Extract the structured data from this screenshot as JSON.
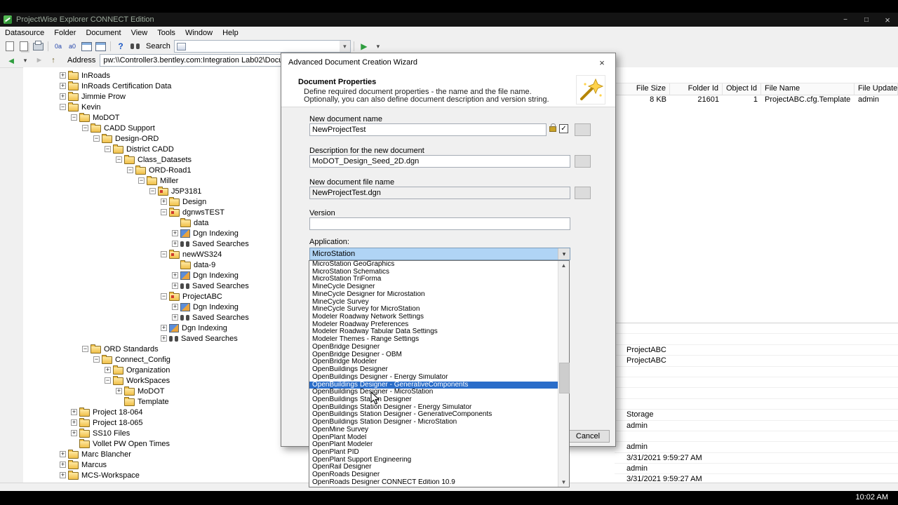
{
  "video": {
    "clock": "10:02 AM"
  },
  "titlebar": {
    "title": "ProjectWise Explorer CONNECT Edition"
  },
  "menubar": {
    "items": [
      "Datasource",
      "Folder",
      "Document",
      "View",
      "Tools",
      "Window",
      "Help"
    ]
  },
  "toolbar": {
    "search_label": "Search"
  },
  "addressbar": {
    "label": "Address",
    "value": "pw:\\\\Controller3.bentley.com:Integration Lab02\\Docum"
  },
  "tree": {
    "items": [
      {
        "label": "InRoads",
        "level": 1,
        "expand": "plus",
        "icon": "folder"
      },
      {
        "label": "InRoads Certification Data",
        "level": 1,
        "expand": "plus",
        "icon": "folder"
      },
      {
        "label": "Jimmie Prow",
        "level": 1,
        "expand": "plus",
        "icon": "folder"
      },
      {
        "label": "Kevin",
        "level": 1,
        "expand": "minus",
        "icon": "folder"
      },
      {
        "label": "MoDOT",
        "level": 2,
        "expand": "minus",
        "icon": "folder"
      },
      {
        "label": "CADD Support",
        "level": 3,
        "expand": "minus",
        "icon": "folder"
      },
      {
        "label": "Design-ORD",
        "level": 4,
        "expand": "minus",
        "icon": "folder"
      },
      {
        "label": "District CADD",
        "level": 5,
        "expand": "minus",
        "icon": "folder"
      },
      {
        "label": "Class_Datasets",
        "level": 6,
        "expand": "minus",
        "icon": "folder"
      },
      {
        "label": "ORD-Road1",
        "level": 7,
        "expand": "minus",
        "icon": "folder"
      },
      {
        "label": "Miller",
        "level": 8,
        "expand": "minus",
        "icon": "folder"
      },
      {
        "label": "J5P3181",
        "level": 9,
        "expand": "minus",
        "icon": "folder-workarea"
      },
      {
        "label": "Design",
        "level": 10,
        "expand": "plus",
        "icon": "folder"
      },
      {
        "label": "dgnwsTEST",
        "level": 10,
        "expand": "minus",
        "icon": "folder-workarea"
      },
      {
        "label": "data",
        "level": 11,
        "expand": "",
        "icon": "folder"
      },
      {
        "label": "Dgn Indexing",
        "level": 11,
        "expand": "plus",
        "icon": "dgn-indexing"
      },
      {
        "label": "Saved Searches",
        "level": 11,
        "expand": "plus",
        "icon": "saved-searches"
      },
      {
        "label": "newWS324",
        "level": 10,
        "expand": "minus",
        "icon": "folder-workarea"
      },
      {
        "label": "data-9",
        "level": 11,
        "expand": "",
        "icon": "folder"
      },
      {
        "label": "Dgn Indexing",
        "level": 11,
        "expand": "plus",
        "icon": "dgn-indexing"
      },
      {
        "label": "Saved Searches",
        "level": 11,
        "expand": "plus",
        "icon": "saved-searches"
      },
      {
        "label": "ProjectABC",
        "level": 10,
        "expand": "minus",
        "icon": "folder-workarea"
      },
      {
        "label": "Dgn Indexing",
        "level": 11,
        "expand": "plus",
        "icon": "dgn-indexing"
      },
      {
        "label": "Saved Searches",
        "level": 11,
        "expand": "plus",
        "icon": "saved-searches"
      },
      {
        "label": "Dgn Indexing",
        "level": 10,
        "expand": "plus",
        "icon": "dgn-indexing"
      },
      {
        "label": "Saved Searches",
        "level": 10,
        "expand": "plus",
        "icon": "saved-searches"
      },
      {
        "label": "ORD Standards",
        "level": 3,
        "expand": "minus",
        "icon": "folder"
      },
      {
        "label": "Connect_Config",
        "level": 4,
        "expand": "minus",
        "icon": "folder"
      },
      {
        "label": "Organization",
        "level": 5,
        "expand": "plus",
        "icon": "folder"
      },
      {
        "label": "WorkSpaces",
        "level": 5,
        "expand": "minus",
        "icon": "folder"
      },
      {
        "label": "MoDOT",
        "level": 6,
        "expand": "plus",
        "icon": "folder"
      },
      {
        "label": "Template",
        "level": 6,
        "expand": "",
        "icon": "folder"
      },
      {
        "label": "Project 18-064",
        "level": 2,
        "expand": "plus",
        "icon": "folder"
      },
      {
        "label": "Project 18-065",
        "level": 2,
        "expand": "plus",
        "icon": "folder"
      },
      {
        "label": "SS10 Files",
        "level": 2,
        "expand": "plus",
        "icon": "folder"
      },
      {
        "label": "Vollet PW Open Times",
        "level": 2,
        "expand": "",
        "icon": "folder"
      },
      {
        "label": "Marc Blancher",
        "level": 1,
        "expand": "plus",
        "icon": "folder"
      },
      {
        "label": "Marcus",
        "level": 1,
        "expand": "plus",
        "icon": "folder"
      },
      {
        "label": "MCS-Workspace",
        "level": 1,
        "expand": "plus",
        "icon": "folder"
      }
    ]
  },
  "grid": {
    "columns": [
      "File Size",
      "Folder Id",
      "Object Id",
      "File Name",
      "File Updated"
    ],
    "row": [
      "8 KB",
      "21601",
      "1",
      "ProjectABC.cfg.Template",
      "admin"
    ]
  },
  "properties_panel": {
    "rows": [
      "",
      "",
      "ProjectABC",
      "ProjectABC",
      "",
      "",
      "",
      "",
      "Storage",
      "admin",
      "",
      "admin",
      "3/31/2021 9:59:27 AM",
      "admin",
      "3/31/2021 9:59:27 AM"
    ]
  },
  "dialog": {
    "title": "Advanced Document Creation Wizard",
    "heading": "Document Properties",
    "desc1": "Define required document properties - the name and the file name.",
    "desc2": "Optionally, you can also define document description and version string.",
    "labels": {
      "name": "New document name",
      "description": "Description for the new document",
      "file_name": "New document file name",
      "version": "Version",
      "application": "Application:"
    },
    "values": {
      "name": "NewProjectTest",
      "description": "MoDOT_Design_Seed_2D.dgn",
      "file_name": "NewProjectTest.dgn",
      "version": "",
      "application": "MicroStation"
    },
    "cancel_label": "Cancel",
    "dropdown": {
      "selected_index": 16,
      "items": [
        "MicroStation GeoGraphics",
        "MicroStation Schematics",
        "MicroStation TriForma",
        "MineCycle Designer",
        "MineCycle Designer for Microstation",
        "MineCycle Survey",
        "MineCycle Survey for MicroStation",
        "Modeler Roadway Network Settings",
        "Modeler Roadway Preferences",
        "Modeler Roadway Tabular Data Settings",
        "Modeler Themes - Range Settings",
        "OpenBridge Designer",
        "OpenBridge Designer - OBM",
        "OpenBridge Modeler",
        "OpenBuildings Designer",
        "OpenBuildings Designer - Energy Simulator",
        "OpenBuildings Designer - GenerativeComponents",
        "OpenBuildings Designer - MicroStation",
        "OpenBuildings Station Designer",
        "OpenBuildings Station Designer - Energy Simulator",
        "OpenBuildings Station Designer - GenerativeComponents",
        "OpenBuildings Station Designer - MicroStation",
        "OpenMine Survey",
        "OpenPlant Model",
        "OpenPlant Modeler",
        "OpenPlant PID",
        "OpenPlant Support Engineering",
        "OpenRail Designer",
        "OpenRoads Designer",
        "OpenRoads Designer CONNECT Edition 10.9"
      ]
    }
  }
}
